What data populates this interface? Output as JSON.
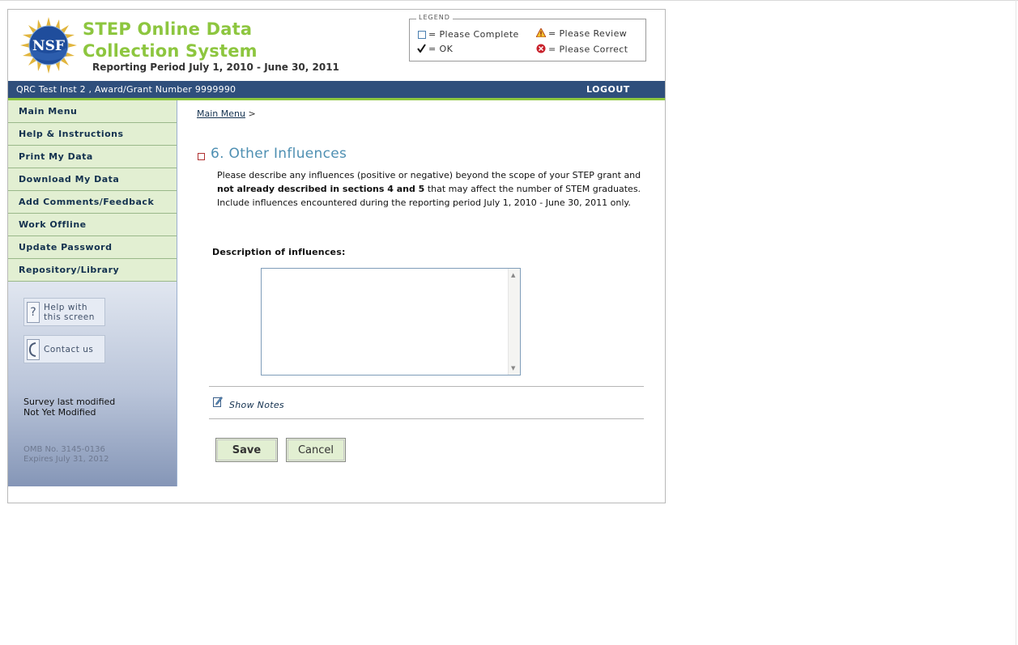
{
  "header": {
    "title": "STEP Online Data Collection System",
    "reporting_period": "Reporting Period July 1, 2010 - June 30, 2011",
    "logo_text": "NSF"
  },
  "legend": {
    "title": "LEGEND",
    "items": [
      {
        "icon": "empty-square-icon",
        "label": "= Please Complete"
      },
      {
        "icon": "warning-icon",
        "label": "= Please Review"
      },
      {
        "icon": "checkmark-icon",
        "label": "= OK"
      },
      {
        "icon": "error-icon",
        "label": "= Please Correct"
      }
    ]
  },
  "bar": {
    "institution": "QRC Test Inst 2 , Award/Grant Number 9999990",
    "logout": "LOGOUT"
  },
  "sidebar": {
    "items": [
      {
        "label": "Main Menu"
      },
      {
        "label": "Help & Instructions"
      },
      {
        "label": "Print My Data"
      },
      {
        "label": "Download My Data"
      },
      {
        "label": "Add Comments/Feedback"
      },
      {
        "label": "Work Offline"
      },
      {
        "label": "Update Password"
      },
      {
        "label": "Repository/Library"
      }
    ],
    "help_button": {
      "line1": "Help with",
      "line2": "this screen"
    },
    "contact_button": {
      "label": "Contact us"
    },
    "modified_label": "Survey last modified",
    "modified_value": "Not Yet Modified",
    "omb_number": "OMB No. 3145-0136",
    "omb_expires": "Expires July 31, 2012"
  },
  "main": {
    "breadcrumb_link": "Main Menu",
    "breadcrumb_sep": ">",
    "section_title": "6. Other Influences",
    "description": {
      "part1": "Please describe any influences (positive or negative) beyond the scope of your STEP grant and ",
      "bold": "not already described in sections 4 and 5",
      "part2": " that may affect the number of STEM graduates. Include influences encountered during the reporting period July 1, 2010 - June 30, 2011 only."
    },
    "field_label": "Description of influences:",
    "field_value": "",
    "show_notes": "Show Notes",
    "save_label": "Save",
    "cancel_label": "Cancel"
  },
  "colors": {
    "title_green": "#8dc63f",
    "bar_navy": "#2f4f7c",
    "nav_green": "#e2efd2",
    "section_blue": "#4e8fb2"
  }
}
